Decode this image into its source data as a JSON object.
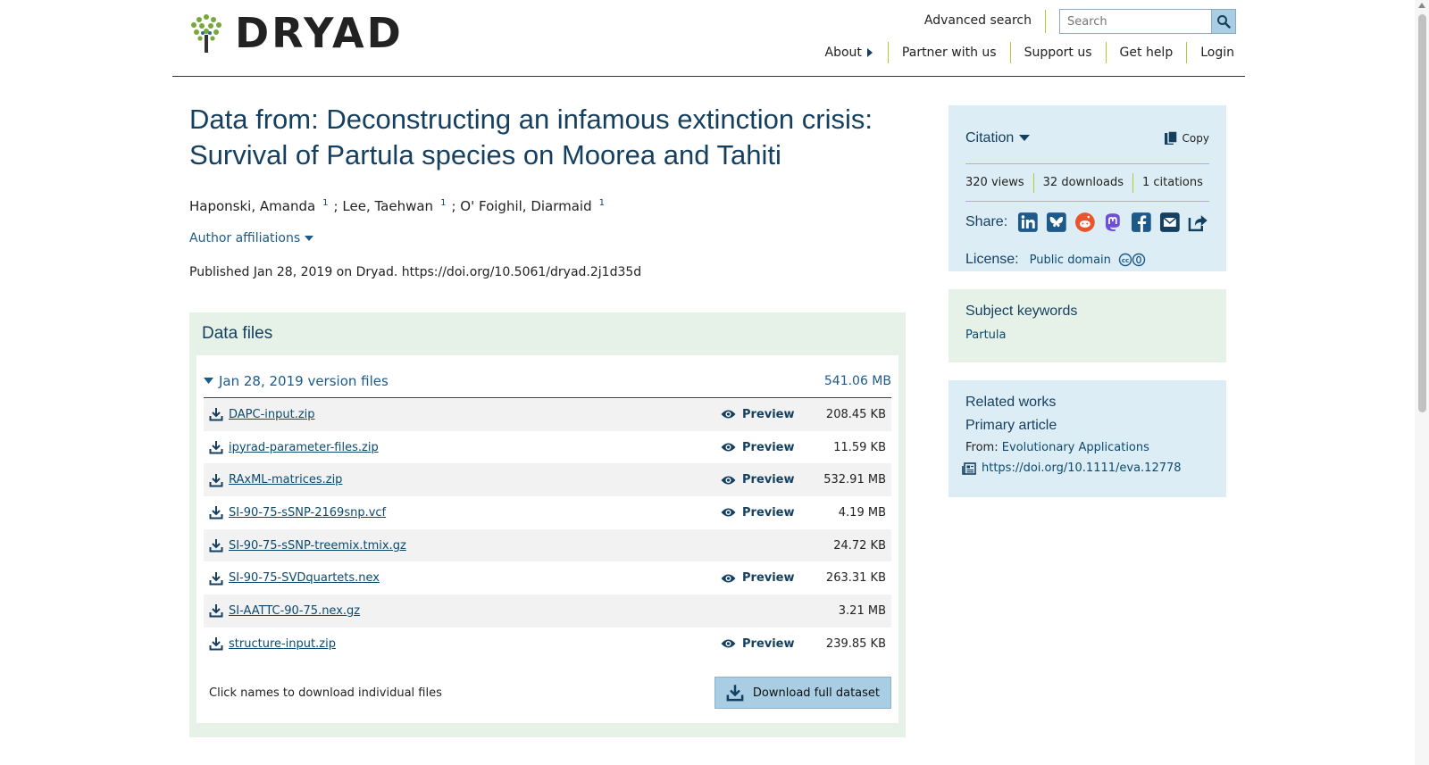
{
  "header": {
    "logo_text": "DRYAD",
    "advanced_search": "Advanced search",
    "search_placeholder": "Search",
    "nav": [
      "About",
      "Partner with us",
      "Support us",
      "Get help",
      "Login"
    ]
  },
  "dataset": {
    "title": "Data from: Deconstructing an infamous extinction crisis: Survival of Partula species on Moorea and Tahiti",
    "authors": [
      {
        "name": "Haponski, Amanda",
        "affil": "1"
      },
      {
        "name": "Lee, Taehwan",
        "affil": "1"
      },
      {
        "name": "O' Foighil, Diarmaid",
        "affil": "1"
      }
    ],
    "author_separator": ";",
    "author_affiliations": "Author affiliations",
    "published": "Published Jan 28, 2019 on Dryad. https://doi.org/10.5061/dryad.2j1d35d"
  },
  "files": {
    "heading": "Data files",
    "version_label": "Jan 28, 2019 version files",
    "version_size": "541.06 MB",
    "preview_label": "Preview",
    "items": [
      {
        "name": "DAPC-input.zip",
        "size": "208.45 KB",
        "preview": true
      },
      {
        "name": "ipyrad-parameter-files.zip",
        "size": "11.59 KB",
        "preview": true
      },
      {
        "name": "RAxML-matrices.zip",
        "size": "532.91 MB",
        "preview": true
      },
      {
        "name": "SI-90-75-sSNP-2169snp.vcf",
        "size": "4.19 MB",
        "preview": true
      },
      {
        "name": "SI-90-75-sSNP-treemix.tmix.gz",
        "size": "24.72 KB",
        "preview": false
      },
      {
        "name": "SI-90-75-SVDquartets.nex",
        "size": "263.31 KB",
        "preview": true
      },
      {
        "name": "SI-AATTC-90-75.nex.gz",
        "size": "3.21 MB",
        "preview": false
      },
      {
        "name": "structure-input.zip",
        "size": "239.85 KB",
        "preview": true
      }
    ],
    "footer_note": "Click names to download individual files",
    "download_full": "Download full dataset"
  },
  "sidebar": {
    "citation": "Citation",
    "copy": "Copy",
    "metrics": {
      "views": "320 views",
      "downloads": "32 downloads",
      "citations": "1 citations"
    },
    "share_label": "Share:",
    "share_icons": [
      "linkedin-icon",
      "bluesky-icon",
      "reddit-icon",
      "mastodon-icon",
      "facebook-icon",
      "email-icon",
      "share-icon"
    ],
    "license_label": "License:",
    "license_link": "Public domain",
    "keywords_heading": "Subject keywords",
    "keyword": "Partula",
    "related_heading": "Related works",
    "related_sub": "Primary article",
    "related_from": "From:",
    "related_journal": "Evolutionary Applications",
    "related_doi": "https://doi.org/10.1111/eva.12778"
  },
  "colors": {
    "title": "#143f5f",
    "link": "#0c4a6e",
    "accent_green": "#b5c936",
    "panel_green": "#e6f2e7",
    "panel_blue": "#dcedf5",
    "button_blue": "#a9cde2"
  }
}
